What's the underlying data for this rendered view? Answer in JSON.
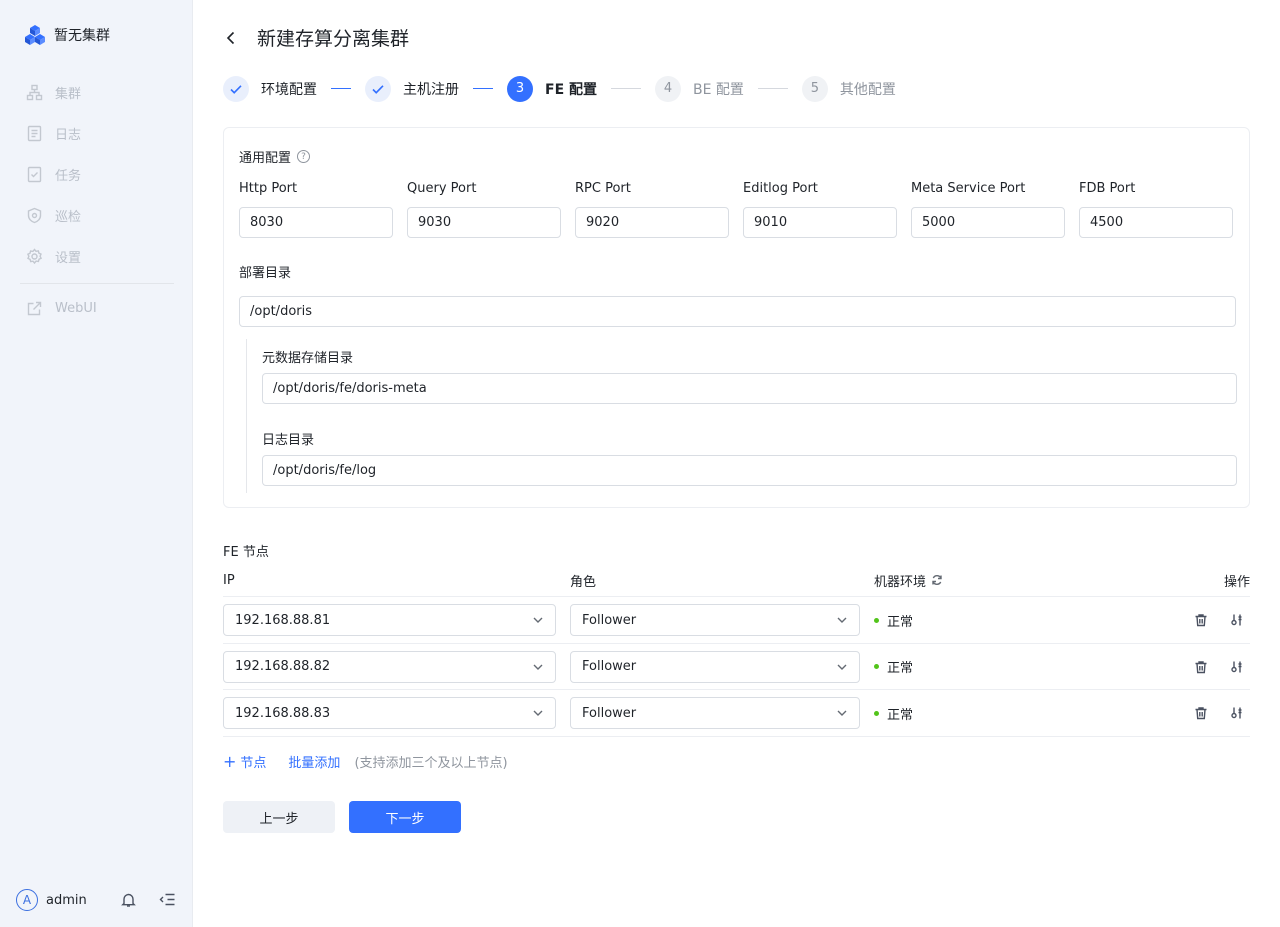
{
  "brand": {
    "name": "暂无集群"
  },
  "sidebar": {
    "items": [
      {
        "label": "集群",
        "icon": "cluster-icon"
      },
      {
        "label": "日志",
        "icon": "log-icon"
      },
      {
        "label": "任务",
        "icon": "task-icon"
      },
      {
        "label": "巡检",
        "icon": "shield-icon"
      },
      {
        "label": "设置",
        "icon": "gear-icon"
      }
    ],
    "webui": {
      "label": "WebUI",
      "icon": "external-link-icon"
    },
    "user": {
      "avatar_letter": "A",
      "name": "admin"
    }
  },
  "page": {
    "title": "新建存算分离集群"
  },
  "steps": [
    {
      "label": "环境配置",
      "status": "done",
      "number": "1"
    },
    {
      "label": "主机注册",
      "status": "done",
      "number": "2"
    },
    {
      "label": "FE 配置",
      "status": "active",
      "number": "3"
    },
    {
      "label": "BE 配置",
      "status": "todo",
      "number": "4"
    },
    {
      "label": "其他配置",
      "status": "todo",
      "number": "5"
    }
  ],
  "general": {
    "title": "通用配置",
    "help": "?",
    "ports": [
      {
        "label": "Http Port",
        "value": "8030"
      },
      {
        "label": "Query Port",
        "value": "9030"
      },
      {
        "label": "RPC Port",
        "value": "9020"
      },
      {
        "label": "Editlog Port",
        "value": "9010"
      },
      {
        "label": "Meta Service Port",
        "value": "5000"
      },
      {
        "label": "FDB Port",
        "value": "4500"
      }
    ],
    "deploy_dir": {
      "label": "部署目录",
      "value": "/opt/doris"
    },
    "meta_dir": {
      "label": "元数据存储目录",
      "value": "/opt/doris/fe/doris-meta"
    },
    "log_dir": {
      "label": "日志目录",
      "value": "/opt/doris/fe/log"
    }
  },
  "fe_nodes": {
    "title": "FE 节点",
    "headers": {
      "ip": "IP",
      "role": "角色",
      "env": "机器环境",
      "ops": "操作"
    },
    "rows": [
      {
        "ip": "192.168.88.81",
        "role": "Follower",
        "status": "正常"
      },
      {
        "ip": "192.168.88.82",
        "role": "Follower",
        "status": "正常"
      },
      {
        "ip": "192.168.88.83",
        "role": "Follower",
        "status": "正常"
      }
    ],
    "add_node": "节点",
    "add_plus": "+",
    "batch_add": "批量添加",
    "hint": "(支持添加三个及以上节点)"
  },
  "actions": {
    "prev": "上一步",
    "next": "下一步"
  },
  "colors": {
    "primary": "#3370ff",
    "status_ok": "#52c41a",
    "sidebar_bg": "#f1f4fa"
  }
}
